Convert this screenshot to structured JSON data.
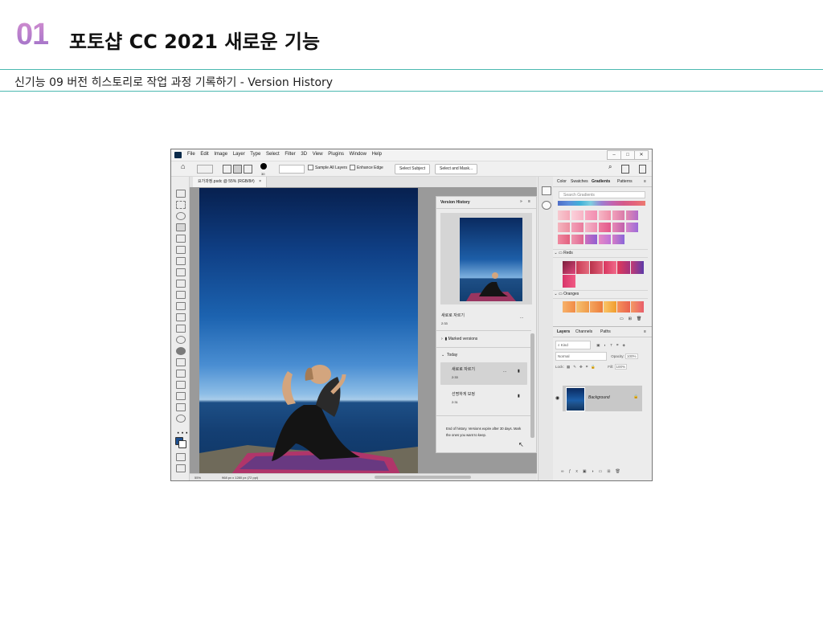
{
  "slide": {
    "number": "01",
    "title": "포토샵 CC 2021 새로운 기능",
    "subtitle": "신기능 09 버전 히스토리로 작업 과정 기록하기 - Version History",
    "accent_color": "#4bb8b0",
    "number_color": "#c77fc0"
  },
  "app": {
    "menus": [
      "File",
      "Edit",
      "Image",
      "Layer",
      "Type",
      "Select",
      "Filter",
      "3D",
      "View",
      "Plugins",
      "Window",
      "Help"
    ],
    "window_controls": [
      "–",
      "□",
      "✕"
    ],
    "options": {
      "brush_size": "30",
      "sample_all_layers": "Sample All Layers",
      "enhance_edge": "Enhance Edge",
      "select_subject": "Select Subject",
      "select_and_mask": "Select and Mask..."
    },
    "doc_tab": "요가과정.psdc @ 55% (RGB/8#)",
    "tab_close": "×",
    "status": {
      "zoom": "55%",
      "dims": "968 px x 1280 px (72 ppi)"
    },
    "version_history": {
      "title": "Version History",
      "preview_caption": "새로로 자르기",
      "preview_time": "2:33",
      "more": "...",
      "marked_versions": "Marked versions",
      "today": "Today",
      "versions": [
        {
          "name": "새로로 자르기",
          "time": "2:33",
          "selected": true
        },
        {
          "name": "선명하게 보정",
          "time": "2:31",
          "selected": false
        }
      ],
      "footer": "End of history. Versions expire after 30 days. Mark the ones you want to keep."
    },
    "right_panel": {
      "tabs": [
        "Color",
        "Swatches",
        "Gradients",
        "Patterns"
      ],
      "active_tab": "Gradients",
      "search_placeholder": "Search Gradients",
      "folders": [
        "Reds",
        "Oranges"
      ],
      "layers_tabs": [
        "Layers",
        "Channels",
        "Paths"
      ],
      "kind": "Kind",
      "blend": "Normal",
      "opacity_label": "Opacity:",
      "opacity": "100%",
      "lock_label": "Lock:",
      "fill_label": "Fill:",
      "fill": "100%",
      "layer_name": "Background"
    }
  }
}
